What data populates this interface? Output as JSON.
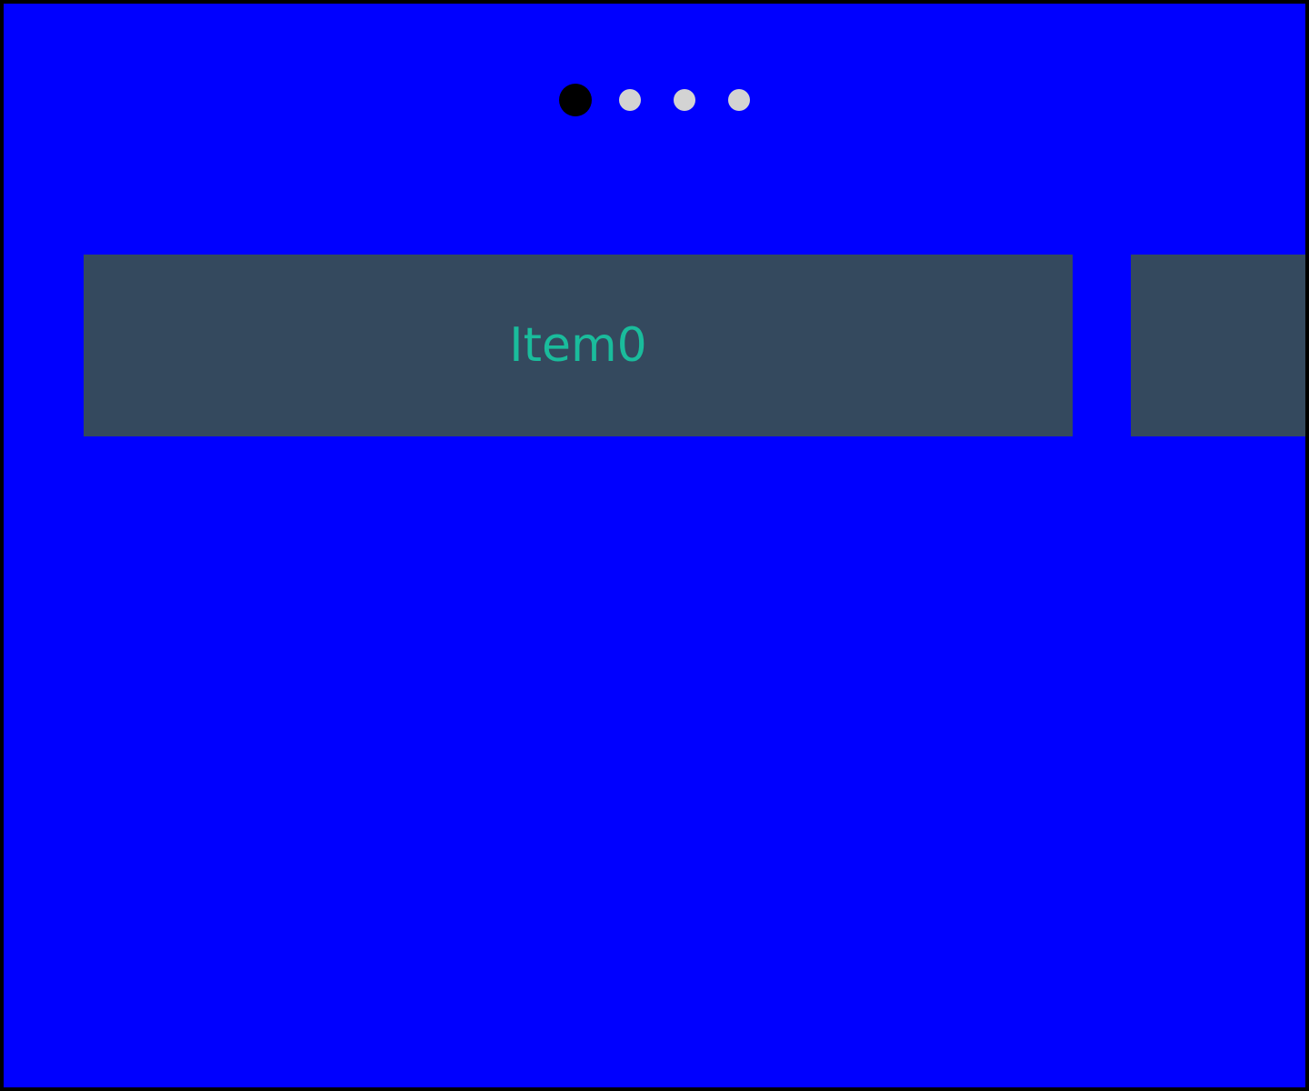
{
  "carousel": {
    "background": "#0000ff",
    "indicators": [
      {
        "state": "active",
        "color": "#000000"
      },
      {
        "state": "inactive",
        "color": "#d3d3d3"
      },
      {
        "state": "inactive",
        "color": "#d3d3d3"
      },
      {
        "state": "inactive",
        "color": "#d3d3d3"
      }
    ],
    "current_index": 1,
    "total": 4,
    "slides": [
      {
        "label": "Item0",
        "background": "#34495e",
        "text_color": "#1abc9c"
      },
      {
        "label": "",
        "background": "#34495e",
        "text_color": "#1abc9c"
      }
    ]
  }
}
